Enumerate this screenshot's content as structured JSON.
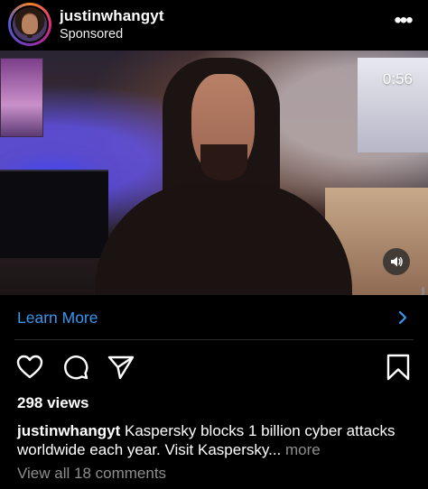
{
  "post": {
    "username": "justinwhangyt",
    "sponsored_label": "Sponsored",
    "more_menu_glyph": "•••"
  },
  "video": {
    "duration": "0:56",
    "volume_icon": "speaker-icon"
  },
  "cta": {
    "label": "Learn More",
    "chevron_icon": "chevron-right-icon",
    "color": "#3897f0"
  },
  "actions": {
    "like_icon": "heart-icon",
    "comment_icon": "comment-bubble-icon",
    "share_icon": "paper-plane-icon",
    "save_icon": "bookmark-icon"
  },
  "stats": {
    "views": "298 views"
  },
  "caption": {
    "username": "justinwhangyt",
    "text": " Kaspersky blocks 1 billion cyber attacks worldwide each year. Visit Kaspersky...",
    "more_label": " more"
  },
  "comments": {
    "view_all_label": "View all 18 comments"
  },
  "colors": {
    "background": "#000000",
    "text": "#ffffff",
    "muted": "#8e8e8e",
    "link": "#3897f0"
  }
}
